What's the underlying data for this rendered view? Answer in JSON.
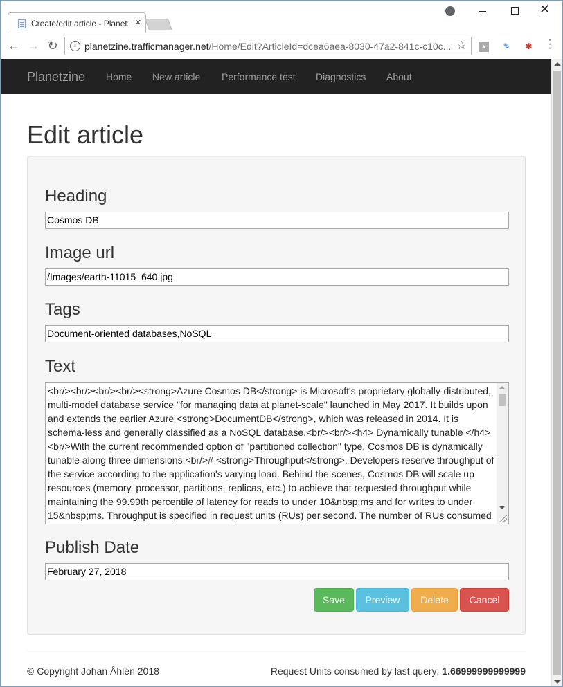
{
  "browser": {
    "tab_title": "Create/edit article - Planetzine",
    "tab_close": "×",
    "url_host": "planetzine.trafficmanager.net",
    "url_path": "/Home/Edit?ArticleId=dcea6aea-8030-47a2-841c-c10c...",
    "icons": [
      "back-icon",
      "forward-icon",
      "reload-icon",
      "info-icon",
      "star-icon",
      "menu-icon"
    ]
  },
  "navbar": {
    "brand": "Planetzine",
    "links": [
      "Home",
      "New article",
      "Performance test",
      "Diagnostics",
      "About"
    ]
  },
  "page": {
    "title": "Edit article"
  },
  "form": {
    "heading_label": "Heading",
    "heading_value": "Cosmos DB",
    "image_label": "Image url",
    "image_value": "/Images/earth-11015_640.jpg",
    "tags_label": "Tags",
    "tags_value": "Document-oriented databases,NoSQL",
    "text_label": "Text",
    "text_value": "<br/><br/><br/><br/><strong>Azure Cosmos DB</strong> is Microsoft's proprietary globally-distributed, multi-model database service \"for managing data at planet-scale\" launched in May 2017. It builds upon and extends the earlier Azure <strong>DocumentDB</strong>, which was released in 2014. It is schema-less and generally classified as a NoSQL database.<br/><br/><h4> Dynamically tunable </h4><br/>With the current recommended option of \"partitioned collection\" type, Cosmos DB is dynamically tunable along three dimensions:<br/># <strong>Throughput</strong>. Developers reserve throughput of the service according to the application's varying load. Behind the scenes, Cosmos DB will scale up resources (memory, processor, partitions, replicas, etc.) to achieve that requested throughput while maintaining the 99.99th percentile of latency for reads to under 10&nbsp;ms and for writes to under 15&nbsp;ms. Throughput is specified in request units (RUs) per second. The number of RUs consumed",
    "date_label": "Publish Date",
    "date_value": "February 27, 2018",
    "buttons": {
      "save": "Save",
      "preview": "Preview",
      "delete": "Delete",
      "cancel": "Cancel"
    },
    "colors": {
      "save": "#5cb85c",
      "preview": "#5bc0de",
      "delete": "#f0ad4e",
      "cancel": "#d9534f"
    }
  },
  "footer": {
    "copyright": "© Copyright Johan Åhlén 2018",
    "ru_label": "Request Units consumed by last query: ",
    "ru_value": "1.66999999999999"
  }
}
